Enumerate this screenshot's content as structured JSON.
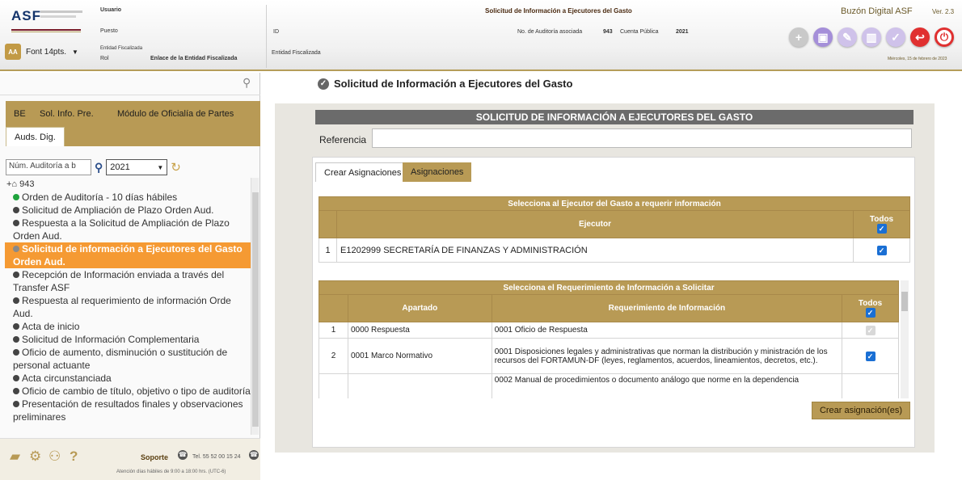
{
  "header": {
    "logo": "ASF",
    "usuario_label": "Usuario",
    "puesto_label": "Puesto",
    "entidad_label": "Entidad Fiscalizada",
    "rol_label": "Rol",
    "rol_value": "Enlace de la Entidad Fiscalizada",
    "font_label": "Font 14pts.",
    "id_label": "ID",
    "entidad_fiscalizada_label": "Entidad Fiscalizada",
    "page_title": "Solicitud de Información a Ejecutores del Gasto",
    "auditoria_label": "No. de Auditoría asociada",
    "auditoria_value": "943",
    "cuenta_label": "Cuenta Pública",
    "cuenta_value": "2021",
    "buzon": "Buzón Digital ASF",
    "version": "Ver. 2.3",
    "date": "Miércoles, 15 de febrero de 2023",
    "actions": [
      {
        "name": "add-action",
        "glyph": "+"
      },
      {
        "name": "save-action",
        "glyph": "▣"
      },
      {
        "name": "edit-action",
        "glyph": "✎"
      },
      {
        "name": "delete-action",
        "glyph": "▥"
      },
      {
        "name": "sign-action",
        "glyph": "✓"
      },
      {
        "name": "back-action",
        "glyph": "↩"
      },
      {
        "name": "power-action",
        "glyph": "⏻"
      }
    ]
  },
  "left": {
    "tabs": [
      "BE",
      "Sol. Info. Pre.",
      "Módulo de Oficialía de Partes",
      "Auds. Dig."
    ],
    "search_placeholder": "Núm. Auditoría a b",
    "year": "2021",
    "tree_root": "943",
    "tree": [
      {
        "text": "Orden de Auditoría - 10 días hábiles",
        "dot": "green"
      },
      {
        "text": "Solicitud de Ampliación de Plazo Orden Aud.",
        "dot": "dark"
      },
      {
        "text": "Respuesta a la Solicitud de Ampliación de Plazo Orden Aud.",
        "dot": "dark"
      },
      {
        "text": "Solicitud de información a Ejecutores del Gasto Orden Aud.",
        "dot": "grey",
        "selected": true
      },
      {
        "text": "Recepción de Información enviada a través del Transfer ASF",
        "dot": "dark"
      },
      {
        "text": "Respuesta al requerimiento de información Orde Aud.",
        "dot": "dark"
      },
      {
        "text": "Acta de inicio",
        "dot": "dark"
      },
      {
        "text": "Solicitud de Información Complementaria",
        "dot": "dark"
      },
      {
        "text": "Oficio de aumento, disminución o sustitución de personal actuante",
        "dot": "dark"
      },
      {
        "text": "Acta circunstanciada",
        "dot": "dark"
      },
      {
        "text": "Oficio de cambio de título, objetivo o tipo de auditoría",
        "dot": "dark"
      },
      {
        "text": "Presentación de resultados finales y observaciones preliminares",
        "dot": "dark"
      }
    ],
    "soporte": "Soporte",
    "tel": "Tel. 55 52 00 15 24",
    "atencion": "Atención días hábiles de 9:00 a 18:00 hrs. (UTC-6)"
  },
  "main": {
    "heading": "Solicitud de Información a Ejecutores del Gasto",
    "card_title": "SOLICITUD DE INFORMACIÓN A EJECUTORES DEL GASTO",
    "referencia_label": "Referencia",
    "referencia_value": "",
    "tab_crear": "Crear Asignaciones",
    "tab_asignaciones": "Asignaciones",
    "ejecutor_caption": "Selecciona al Ejecutor del Gasto a requerir información",
    "ejecutor_header": "Ejecutor",
    "todos_label": "Todos",
    "ejecutor_rows": [
      {
        "num": "1",
        "ejecutor": "E1202999 SECRETARÍA DE FINANZAS Y ADMINISTRACIÓN",
        "checked": true
      }
    ],
    "req_caption": "Selecciona el Requerimiento de Información a Solicitar",
    "apartado_header": "Apartado",
    "req_header": "Requerimiento de Información",
    "req_rows": [
      {
        "num": "1",
        "apartado": "0000 Respuesta",
        "req": "0001 Oficio de Respuesta",
        "checked": true,
        "disabled": true
      },
      {
        "num": "2",
        "apartado": "0001 Marco Normativo",
        "req": "0001 Disposiciones legales y administrativas que norman la distribución y ministración de los recursos del FORTAMUN-DF (leyes, reglamentos, acuerdos, lineamientos, decretos, etc.).",
        "checked": true,
        "disabled": false
      },
      {
        "num": "",
        "apartado": "",
        "req": "0002 Manual de procedimientos o documento análogo que norme en la dependencia",
        "checked": false,
        "disabled": false
      }
    ],
    "crear_button": "Crear asignación(es)"
  }
}
